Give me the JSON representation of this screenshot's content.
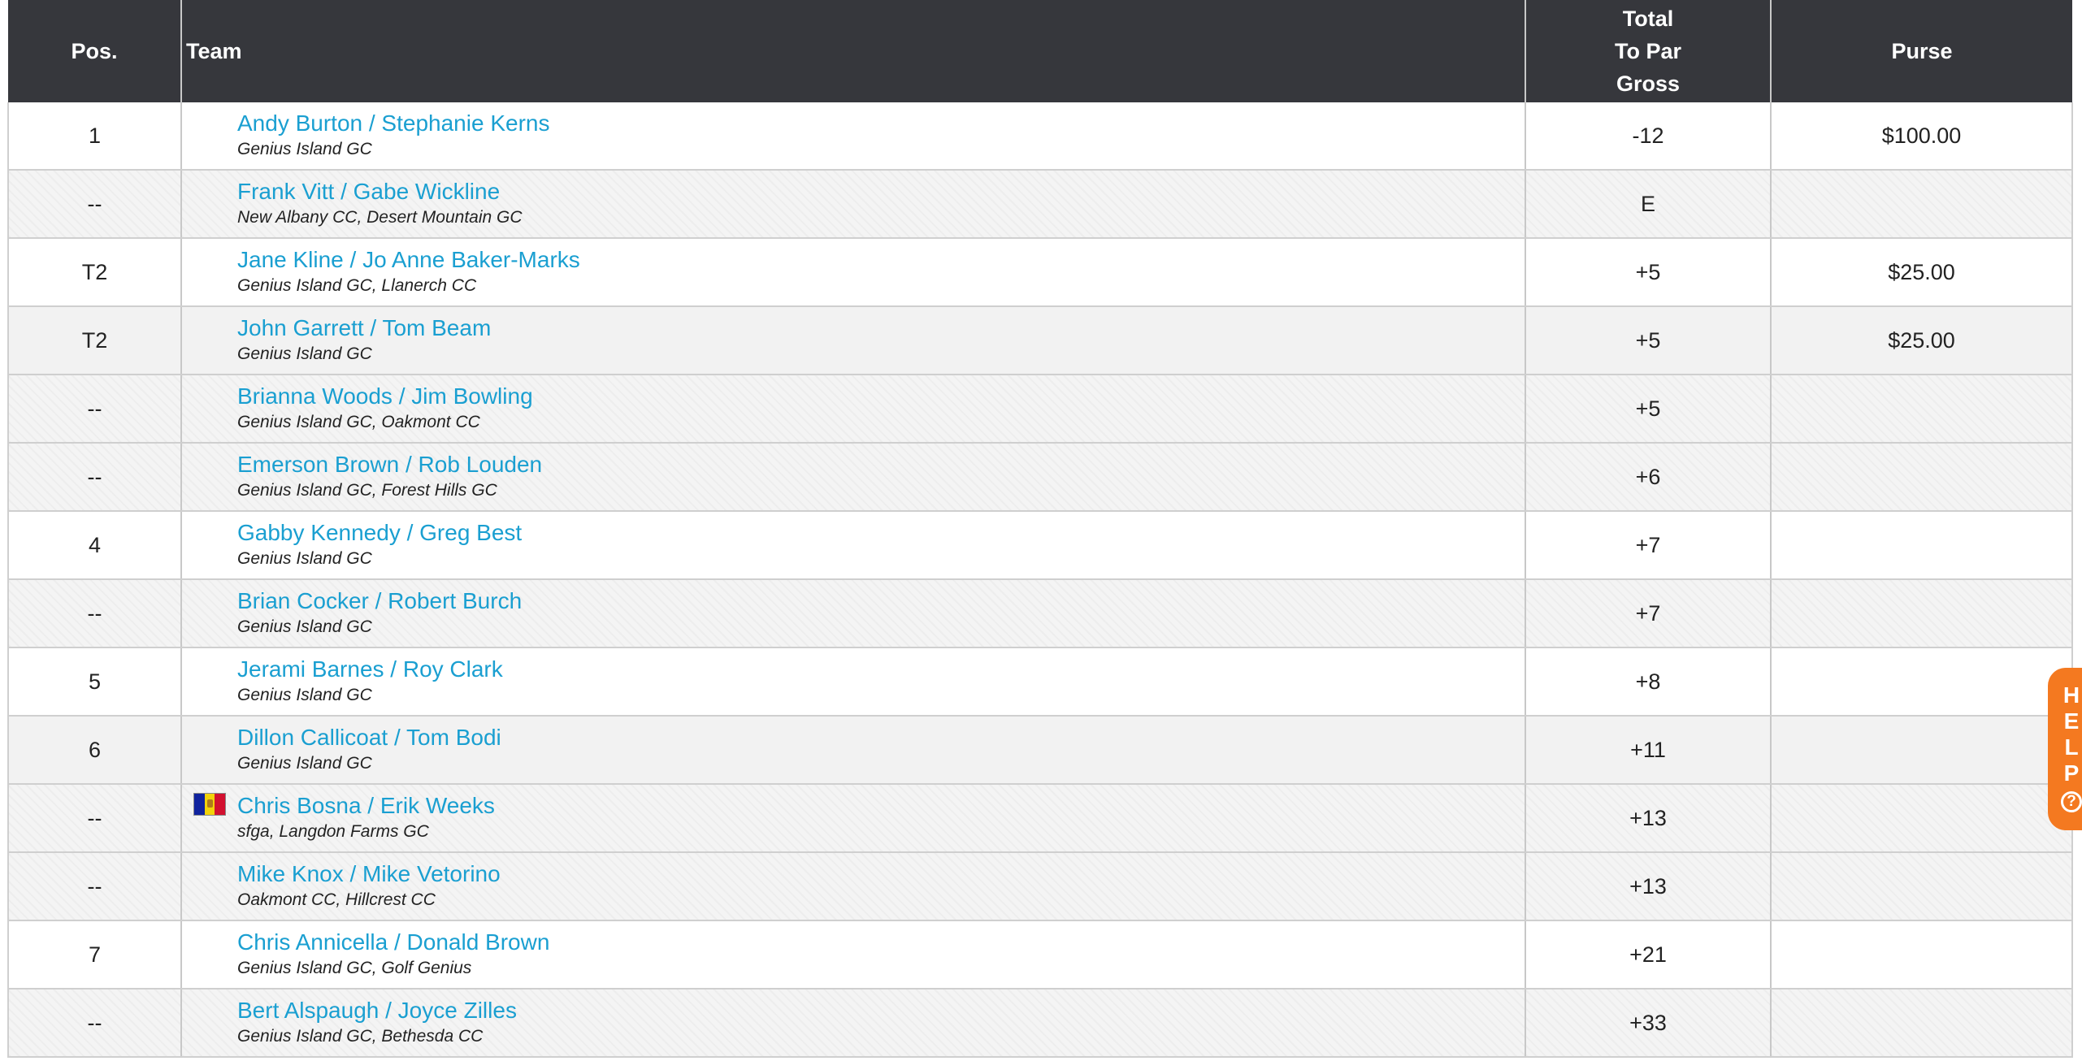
{
  "columns": {
    "pos": "Pos.",
    "team": "Team",
    "total_1": "Total",
    "total_2": "To Par",
    "total_3": "Gross",
    "purse": "Purse"
  },
  "rows": [
    {
      "pos": "1",
      "team": "Andy Burton / Stephanie Kerns",
      "club": "Genius Island GC",
      "total": "-12",
      "purse": "$100.00",
      "style": "odd"
    },
    {
      "pos": "--",
      "team": "Frank Vitt / Gabe Wickline",
      "club": "New Albany CC, Desert Mountain GC",
      "total": "E",
      "purse": "",
      "style": "striped"
    },
    {
      "pos": "T2",
      "team": "Jane Kline / Jo Anne Baker-Marks",
      "club": "Genius Island GC, Llanerch CC",
      "total": "+5",
      "purse": "$25.00",
      "style": "odd"
    },
    {
      "pos": "T2",
      "team": "John Garrett / Tom Beam",
      "club": "Genius Island GC",
      "total": "+5",
      "purse": "$25.00",
      "style": "grey"
    },
    {
      "pos": "--",
      "team": "Brianna Woods / Jim Bowling",
      "club": "Genius Island GC, Oakmont CC",
      "total": "+5",
      "purse": "",
      "style": "striped"
    },
    {
      "pos": "--",
      "team": "Emerson Brown / Rob Louden",
      "club": "Genius Island GC, Forest Hills GC",
      "total": "+6",
      "purse": "",
      "style": "striped"
    },
    {
      "pos": "4",
      "team": "Gabby Kennedy / Greg Best",
      "club": "Genius Island GC",
      "total": "+7",
      "purse": "",
      "style": "odd"
    },
    {
      "pos": "--",
      "team": "Brian Cocker / Robert Burch",
      "club": "Genius Island GC",
      "total": "+7",
      "purse": "",
      "style": "striped"
    },
    {
      "pos": "5",
      "team": "Jerami Barnes / Roy Clark",
      "club": "Genius Island GC",
      "total": "+8",
      "purse": "",
      "style": "odd"
    },
    {
      "pos": "6",
      "team": "Dillon Callicoat / Tom Bodi",
      "club": "Genius Island GC",
      "total": "+11",
      "purse": "",
      "style": "grey"
    },
    {
      "pos": "--",
      "team": "Chris Bosna / Erik Weeks",
      "club": "sfga, Langdon Farms GC",
      "total": "+13",
      "purse": "",
      "style": "striped",
      "flag": "andorra-flag"
    },
    {
      "pos": "--",
      "team": "Mike Knox / Mike Vetorino",
      "club": "Oakmont CC, Hillcrest CC",
      "total": "+13",
      "purse": "",
      "style": "striped"
    },
    {
      "pos": "7",
      "team": "Chris Annicella / Donald Brown",
      "club": "Genius Island GC, Golf Genius",
      "total": "+21",
      "purse": "",
      "style": "odd"
    },
    {
      "pos": "--",
      "team": "Bert Alspaugh / Joyce Zilles",
      "club": "Genius Island GC, Bethesda CC",
      "total": "+33",
      "purse": "",
      "style": "striped"
    }
  ],
  "help": {
    "label": "HELP",
    "icon": "question-circle-icon",
    "icon_glyph": "?"
  },
  "colors": {
    "header_bg": "#36373c",
    "link": "#1a9fd1",
    "help_bg": "#f47920"
  }
}
